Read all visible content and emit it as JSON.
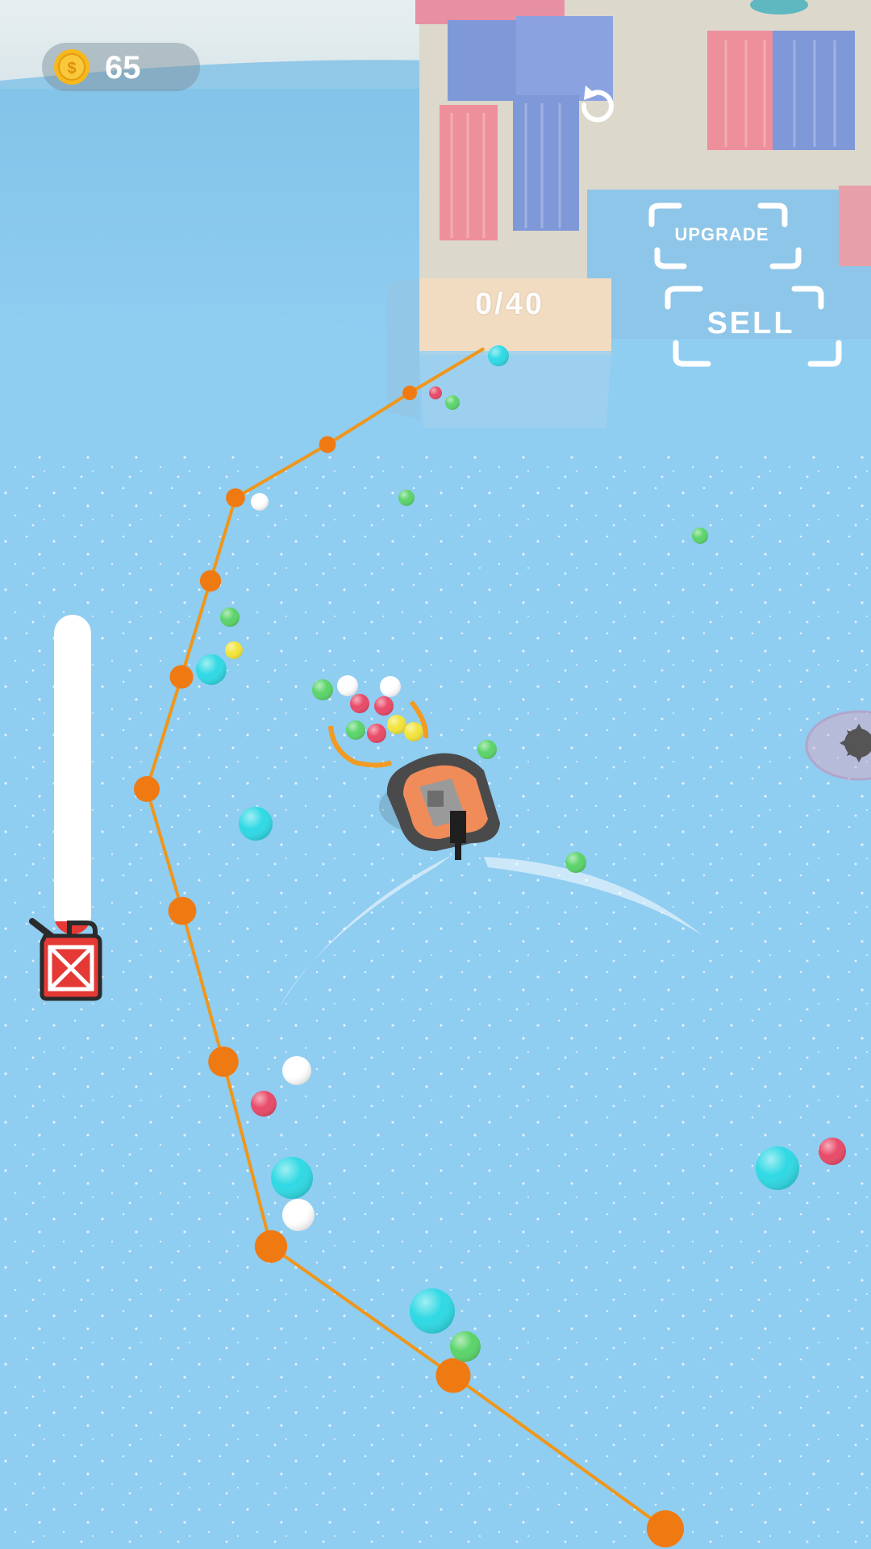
{
  "hud": {
    "coins": "65",
    "coin_icon": "coin-icon",
    "restart_icon": "restart-icon"
  },
  "dock": {
    "capacity_label": "0/40",
    "upgrade_label": "UPGRADE",
    "sell_label": "SELL"
  },
  "fuel": {
    "level": 0.04,
    "icon": "fuel-can-icon"
  },
  "colors": {
    "water": "#8fcdf1",
    "rope": "#f0961a",
    "buoy": "#f07a12",
    "fuel_fill": "#e53935",
    "coin": "#f7b81b"
  }
}
